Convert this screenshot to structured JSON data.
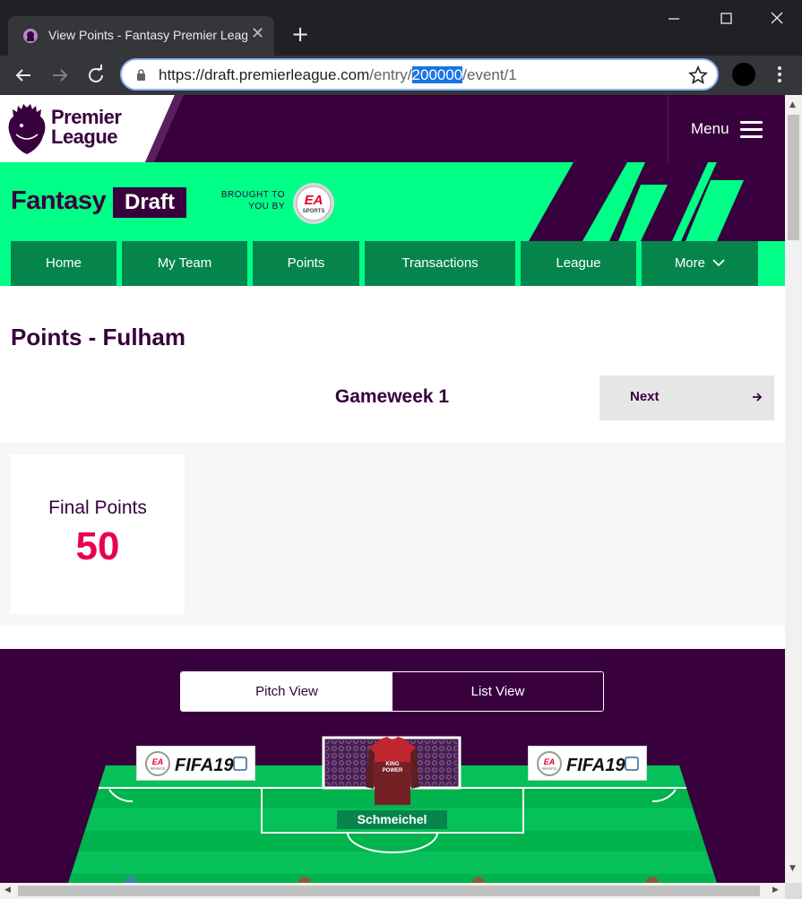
{
  "browser": {
    "tab_title": "View Points - Fantasy Premier League",
    "new_tab": "+",
    "close_tab": "✕",
    "url_host": "https://draft.premierleague.com",
    "url_path_before": "/entry/",
    "url_selected": "200000",
    "url_path_after": "/event/1"
  },
  "header": {
    "brand_line1": "Premier",
    "brand_line2": "League",
    "menu_label": "Menu"
  },
  "fpl": {
    "fantasy": "Fantasy",
    "draft": "Draft",
    "brought_line1": "BROUGHT TO",
    "brought_line2": "YOU BY",
    "sponsor_top": "EA",
    "sponsor_bottom": "SPORTS"
  },
  "nav": {
    "items": [
      "Home",
      "My Team",
      "Points",
      "Transactions",
      "League",
      "More"
    ]
  },
  "page": {
    "title": "Points - Fulham",
    "gameweek": "Gameweek 1",
    "next_label": "Next",
    "final_points_label": "Final Points",
    "final_points_value": "50"
  },
  "pitch": {
    "toggle_pitch": "Pitch View",
    "toggle_list": "List View",
    "ad_text": "FIFA19",
    "ad_brand_top": "EA",
    "ad_brand_bottom": "SPORTS",
    "shirt_sponsor_line1": "KING",
    "shirt_sponsor_line2": "POWER",
    "goalkeeper": "Schmeichel"
  },
  "colors": {
    "pl_purple": "#38003c",
    "fpl_green": "#00ff87",
    "nav_green": "#05854c",
    "points_pink": "#e90052",
    "pitch_green": "#00b34c"
  }
}
